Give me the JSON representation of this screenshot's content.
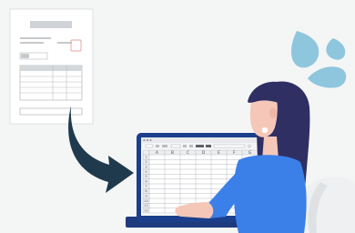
{
  "illustration": {
    "subject": "paper-form-to-spreadsheet",
    "colors": {
      "background": "#f4f5f5",
      "arrow": "#1f3a4d",
      "laptop": "#1b3f8a",
      "shirt": "#3b7fe8",
      "hair": "#2f2f63",
      "skin": "#f5c7b8",
      "drops": "#8ec6dd",
      "chair": "#eef0f1"
    }
  },
  "spreadsheet": {
    "column_headers": [
      "A",
      "B",
      "C",
      "D",
      "E",
      "F",
      "G"
    ],
    "row_numbers": [
      "1",
      "2",
      "3",
      "4",
      "5",
      "6",
      "7",
      "8",
      "9",
      "10",
      "11",
      "12"
    ]
  }
}
